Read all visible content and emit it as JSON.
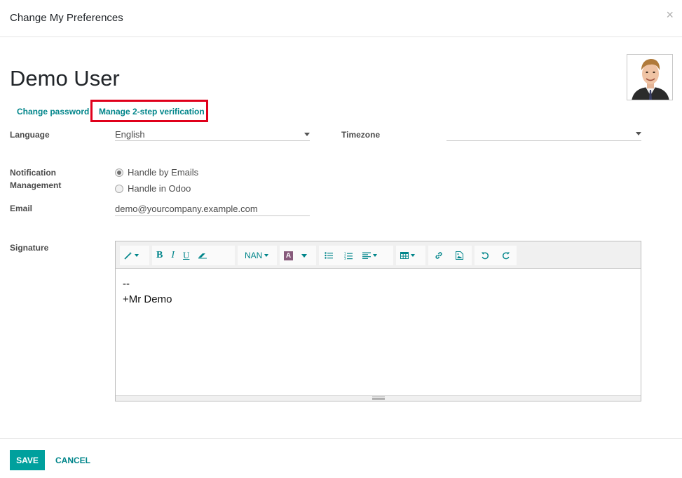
{
  "dialog": {
    "title": "Change My Preferences",
    "close_label": "×"
  },
  "user": {
    "name": "Demo User"
  },
  "actions": {
    "change_password": "Change password",
    "manage_2fa": "Manage 2-step verification"
  },
  "form": {
    "language": {
      "label": "Language",
      "value": "English"
    },
    "timezone": {
      "label": "Timezone",
      "value": ""
    },
    "notification": {
      "label_line1": "Notification",
      "label_line2": "Management",
      "options": [
        "Handle by Emails",
        "Handle in Odoo"
      ],
      "selected": "Handle by Emails"
    },
    "email": {
      "label": "Email",
      "value": "demo@yourcompany.example.com"
    },
    "signature": {
      "label": "Signature",
      "lines": [
        "--",
        "+Mr Demo"
      ]
    }
  },
  "toolbar": {
    "font_size_label": "NAN"
  },
  "footer": {
    "save_label": "SAVE",
    "cancel_label": "CANCEL"
  },
  "colors": {
    "accent": "#00a09d",
    "link": "#00858a",
    "highlight_border": "#e0001b"
  }
}
